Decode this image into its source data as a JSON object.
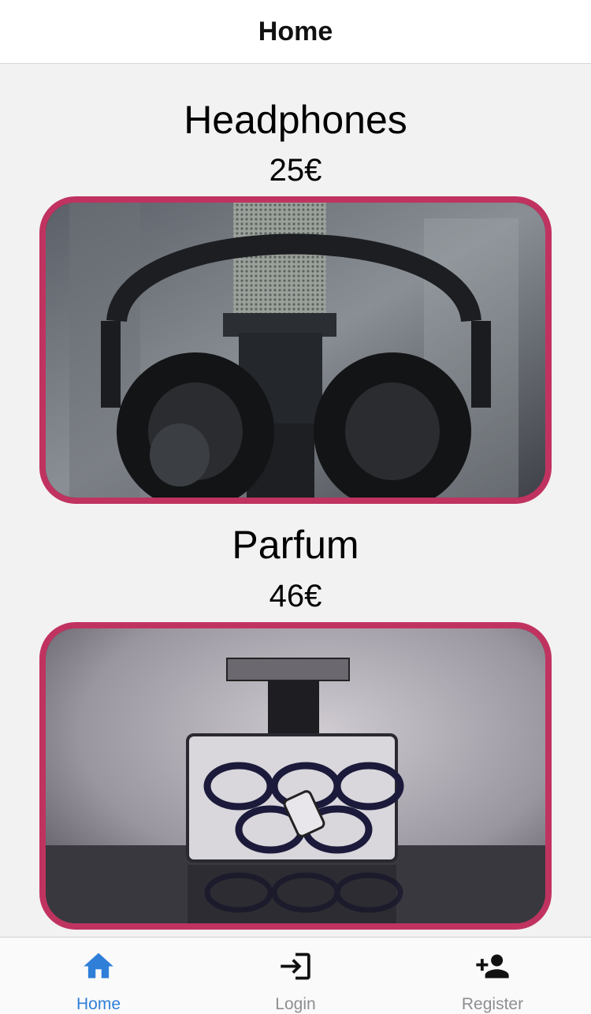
{
  "header": {
    "title": "Home"
  },
  "products": [
    {
      "name": "Headphones",
      "price": "25€"
    },
    {
      "name": "Parfum",
      "price": "46€"
    }
  ],
  "tabs": [
    {
      "label": "Home",
      "icon": "home-icon",
      "active": true
    },
    {
      "label": "Login",
      "icon": "login-icon",
      "active": false
    },
    {
      "label": "Register",
      "icon": "add-user-icon",
      "active": false
    }
  ],
  "colors": {
    "card_border": "#c03360",
    "tab_active": "#2f7fd9",
    "tab_inactive": "#8e8e93",
    "background": "#f2f2f2"
  }
}
